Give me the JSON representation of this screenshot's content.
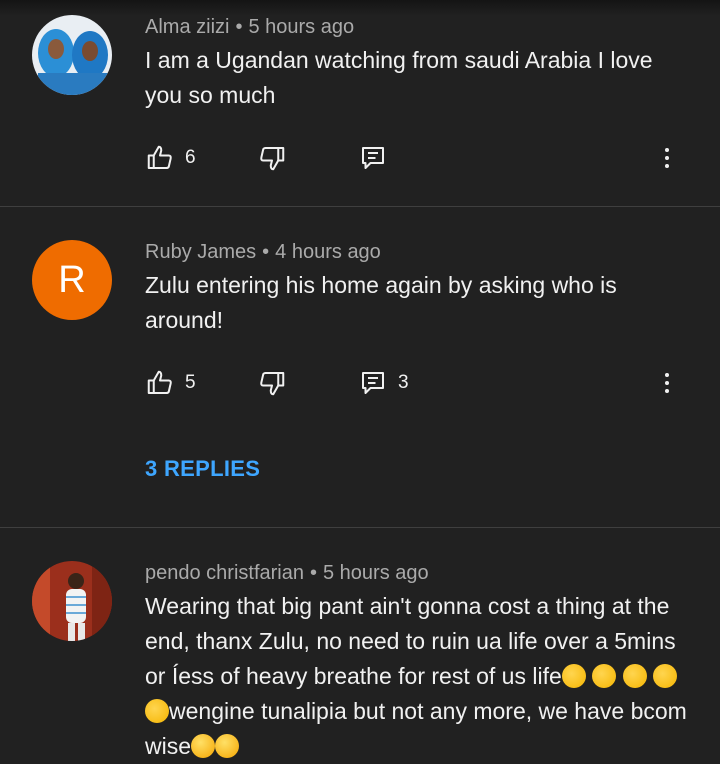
{
  "comments": [
    {
      "author": "Alma ziizi",
      "time": "5 hours ago",
      "text": "I am a Ugandan watching from saudi Arabia I love you so much",
      "likes": "6",
      "replies_count": ""
    },
    {
      "author": "Ruby James",
      "initial": "R",
      "avatar_color": "#ef6c00",
      "time": "4 hours ago",
      "text": "Zulu entering his home again by asking who is around!",
      "likes": "5",
      "replies_count": "3",
      "view_replies": "3 REPLIES"
    },
    {
      "author": "pendo christfarian",
      "time": "5 hours ago",
      "text": "Wearing that big pant ain't gonna cost a thing at the end, thanx Zulu, no need to ruin ua life over a 5mins or Íess of heavy breathe for rest of us life",
      "text_tail": "wengine tunalipia but not any more, we have bcom wise"
    }
  ],
  "separator": "•",
  "colors": {
    "background": "#212121",
    "link": "#3ea6ff",
    "meta": "#aaaaaa"
  },
  "icons": [
    "thumbs-up-icon",
    "thumbs-down-icon",
    "reply-icon",
    "more-vert-icon",
    "clap-emoji",
    "laugh-emoji"
  ]
}
